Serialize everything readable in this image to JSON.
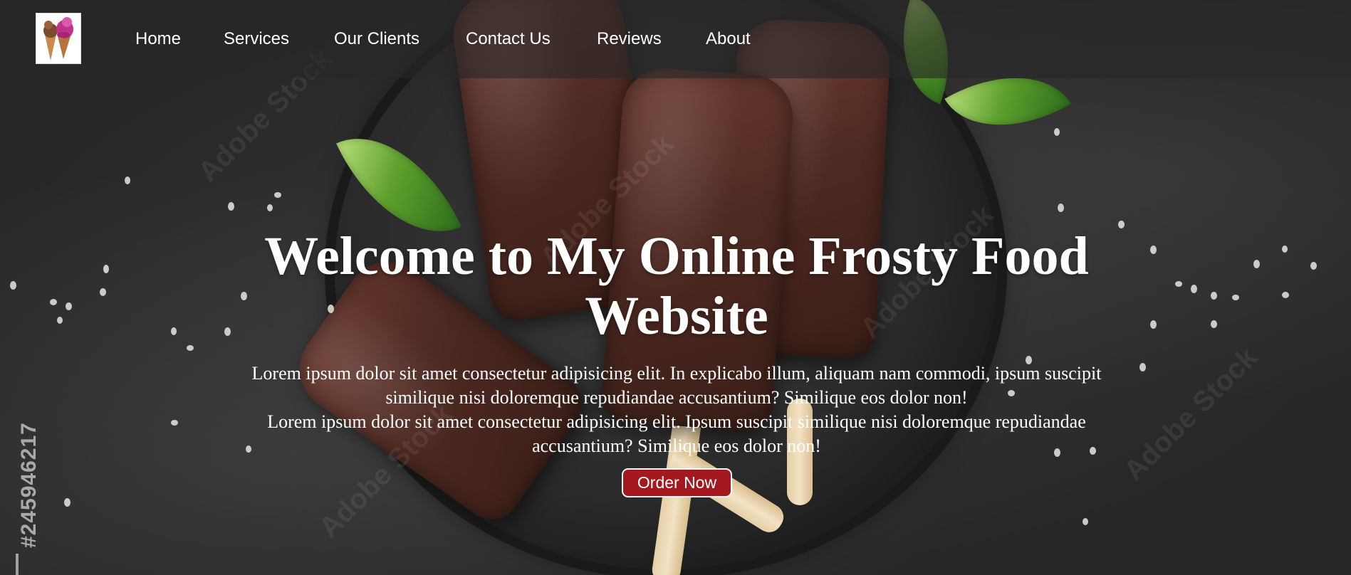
{
  "nav": {
    "logo_icon": "ice-cream-cones-icon",
    "links": [
      "Home",
      "Services",
      "Our Clients",
      "Contact Us",
      "Reviews",
      "About"
    ]
  },
  "hero": {
    "title": "Welcome to My Online Frosty Food Website",
    "paragraph_1_line_1": "Lorem ipsum dolor sit amet consectetur adipisicing elit. In explicabo illum, aliquam nam commodi, ipsum suscipit",
    "paragraph_1_line_2": "similique nisi doloremque repudiandae accusantium? Similique eos dolor non!",
    "paragraph_2_line_1": "Lorem ipsum dolor sit amet consectetur adipisicing elit. Ipsum suscipit similique nisi doloremque repudiandae",
    "paragraph_2_line_2": "accusantium? Similique eos dolor non!",
    "button_label": "Order Now",
    "background_image": "chocolate-popsicles-on-plate",
    "watermark_id": "#245946217"
  },
  "colors": {
    "button": "#a3191e",
    "navbar": "rgba(40,40,40,0.62)",
    "text": "#ffffff"
  }
}
